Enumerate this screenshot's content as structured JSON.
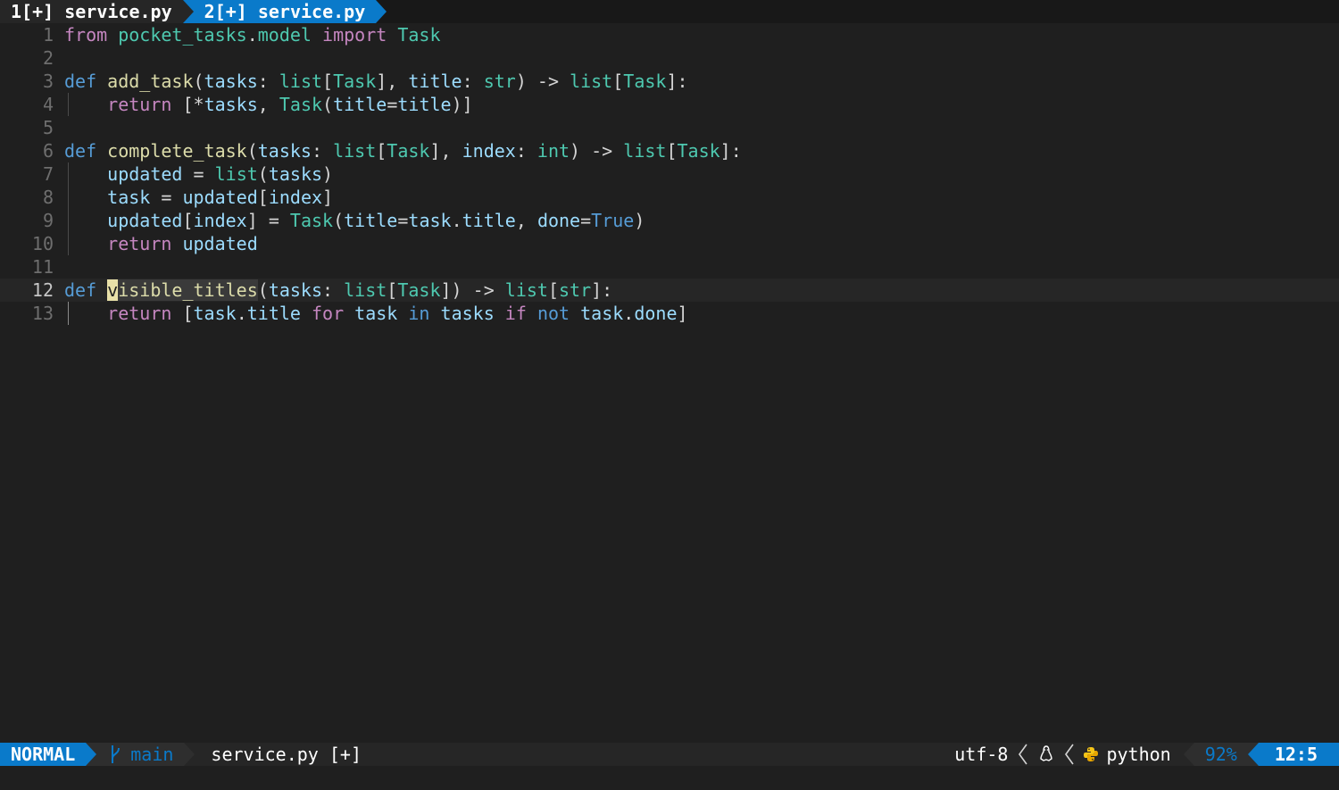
{
  "tabline": {
    "tabs": [
      {
        "label": "1[+] service.py",
        "active": false
      },
      {
        "label": "2[+] service.py",
        "active": true
      }
    ]
  },
  "editor": {
    "current_line": 12,
    "lines": [
      {
        "n": "1"
      },
      {
        "n": "2"
      },
      {
        "n": "3"
      },
      {
        "n": "4"
      },
      {
        "n": "5"
      },
      {
        "n": "6"
      },
      {
        "n": "7"
      },
      {
        "n": "8"
      },
      {
        "n": "9"
      },
      {
        "n": "10"
      },
      {
        "n": "11"
      },
      {
        "n": "12"
      },
      {
        "n": "13"
      }
    ],
    "code": {
      "l1": [
        "from",
        "pocket_tasks",
        ".",
        "model",
        "import",
        "Task"
      ],
      "l3": [
        "def",
        "add_task",
        "(",
        "tasks",
        ":",
        "list",
        "[",
        "Task",
        "],",
        "title",
        ":",
        "str",
        ")",
        "->",
        "list",
        "[",
        "Task",
        "]:"
      ],
      "l4": [
        "return",
        "[*",
        "tasks",
        ",",
        "Task",
        "(",
        "title",
        "=",
        "title",
        ")]"
      ],
      "l6": [
        "def",
        "complete_task",
        "(",
        "tasks",
        ":",
        "list",
        "[",
        "Task",
        "],",
        "index",
        ":",
        "int",
        ")",
        "->",
        "list",
        "[",
        "Task",
        "]:"
      ],
      "l7": [
        "updated",
        "=",
        "list",
        "(",
        "tasks",
        ")"
      ],
      "l8": [
        "task",
        "=",
        "updated",
        "[",
        "index",
        "]"
      ],
      "l9": [
        "updated",
        "[",
        "index",
        "]",
        "=",
        "Task",
        "(",
        "title",
        "=",
        "task",
        ".",
        "title",
        ",",
        "done",
        "=",
        "True",
        ")"
      ],
      "l10": [
        "return",
        "updated"
      ],
      "l12": [
        "def",
        "v",
        "isible_titles",
        "(",
        "tasks",
        ":",
        "list",
        "[",
        "Task",
        "])",
        "->",
        "list",
        "[",
        "str",
        "]:"
      ],
      "l13": [
        "return",
        "[",
        "task",
        ".",
        "title",
        "for",
        "task",
        "in",
        "tasks",
        "if",
        "not",
        "task",
        ".",
        "done",
        "]"
      ]
    }
  },
  "statusline": {
    "mode": "NORMAL",
    "branch": "main",
    "file": "service.py [+]",
    "encoding": "utf-8",
    "os_icon": "linux-tux-icon",
    "filetype": "python",
    "percent": "92%",
    "position": "12:5"
  },
  "colors": {
    "accent": "#0a7aca",
    "background": "#1f1f1f",
    "keyword": "#569cd6",
    "control_keyword": "#c586c0",
    "function": "#dcdcaa",
    "type": "#4ec9b0",
    "variable": "#9cdcfe"
  }
}
